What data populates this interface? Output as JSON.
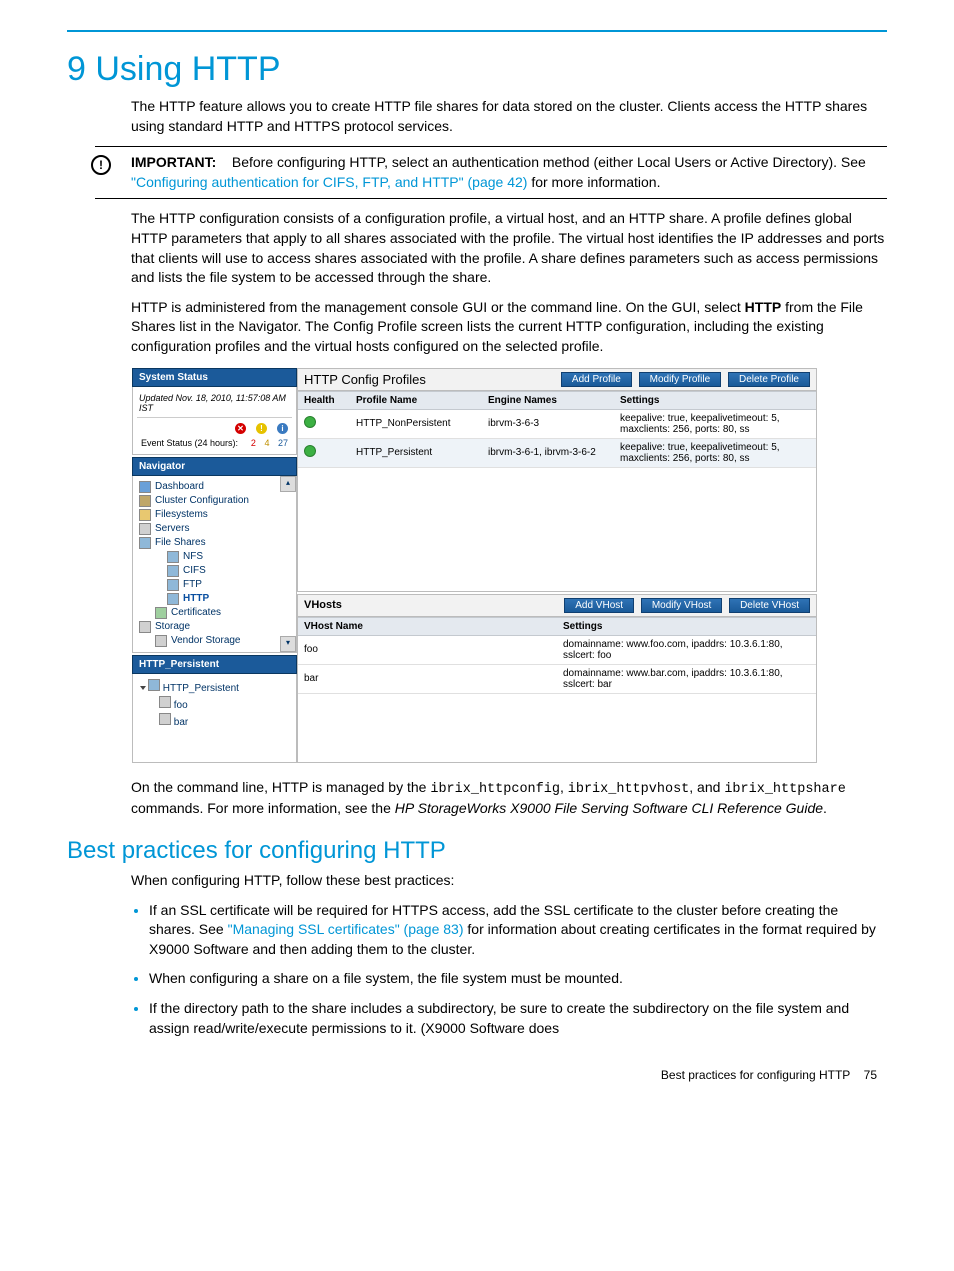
{
  "heading": "9 Using HTTP",
  "intro": "The HTTP feature allows you to create HTTP file shares for data stored on the cluster. Clients access the HTTP shares using standard HTTP and HTTPS protocol services.",
  "important": {
    "label": "IMPORTANT:",
    "text_before_link": "Before configuring HTTP, select an authentication method (either Local Users or Active Directory). See ",
    "link_text": "\"Configuring authentication for CIFS, FTP, and HTTP\" (page 42)",
    "text_after_link": " for more information."
  },
  "para2": "The HTTP configuration consists of a configuration profile, a virtual host, and an HTTP share. A profile defines global HTTP parameters that apply to all shares associated with the profile. The virtual host identifies the IP addresses and ports that clients will use to access shares associated with the profile. A share defines parameters such as access permissions and lists the file system to be accessed through the share.",
  "para3_pre": "HTTP is administered from the management console GUI or the command line. On the GUI, select ",
  "para3_bold": "HTTP",
  "para3_post": " from the File Shares list in the Navigator. The Config Profile screen lists the current HTTP configuration, including the existing configuration profiles and the virtual hosts configured on the selected profile.",
  "screenshot": {
    "system_status": {
      "title": "System Status",
      "updated": "Updated Nov. 18, 2010, 11:57:08 AM IST",
      "event_label": "Event Status (24 hours):",
      "counts": {
        "red": "2",
        "yellow": "4",
        "blue": "27"
      }
    },
    "navigator": {
      "title": "Navigator",
      "items": [
        {
          "label": "Dashboard",
          "icon": "chart"
        },
        {
          "label": "Cluster Configuration",
          "icon": "gear"
        },
        {
          "label": "Filesystems",
          "icon": "fold"
        },
        {
          "label": "Servers",
          "icon": "srv"
        },
        {
          "label": "File Shares",
          "icon": "share"
        }
      ],
      "shares": [
        {
          "label": "NFS"
        },
        {
          "label": "CIFS"
        },
        {
          "label": "FTP"
        },
        {
          "label": "HTTP",
          "selected": true
        }
      ],
      "tail": [
        {
          "label": "Certificates",
          "icon": "cert"
        },
        {
          "label": "Storage",
          "icon": "srv"
        },
        {
          "label": "Vendor Storage",
          "icon": "srv",
          "sub": true
        }
      ]
    },
    "config_profiles": {
      "title": "HTTP Config Profiles",
      "buttons": [
        "Add Profile",
        "Modify Profile",
        "Delete Profile"
      ],
      "columns": [
        "Health",
        "Profile Name",
        "Engine Names",
        "Settings"
      ],
      "rows": [
        [
          "ok",
          "HTTP_NonPersistent",
          "ibrvm-3-6-3",
          "keepalive: true, keepalivetimeout: 5, maxclients: 256, ports: 80, ss"
        ],
        [
          "ok",
          "HTTP_Persistent",
          "ibrvm-3-6-1, ibrvm-3-6-2",
          "keepalive: true, keepalivetimeout: 5, maxclients: 256, ports: 80, ss"
        ]
      ]
    },
    "hp_tree": {
      "title": "HTTP_Persistent",
      "root": "HTTP_Persistent",
      "children": [
        "foo",
        "bar"
      ]
    },
    "vhosts": {
      "title": "VHosts",
      "buttons": [
        "Add VHost",
        "Modify VHost",
        "Delete VHost"
      ],
      "columns": [
        "VHost Name",
        "Settings"
      ],
      "rows": [
        [
          "foo",
          "domainname: www.foo.com, ipaddrs: 10.3.6.1:80, sslcert: foo"
        ],
        [
          "bar",
          "domainname: www.bar.com, ipaddrs: 10.3.6.1:80, sslcert: bar"
        ]
      ]
    }
  },
  "cmdline": {
    "pre": "On the command line, HTTP is managed by the ",
    "c1": "ibrix_httpconfig",
    "sep1": ", ",
    "c2": "ibrix_httpvhost",
    "sep2": ", and ",
    "c3": "ibrix_httpshare",
    "post1": " commands. For more information, see the ",
    "emph": "HP StorageWorks X9000 File Serving Software CLI Reference Guide",
    "post2": "."
  },
  "h2": "Best practices for configuring HTTP",
  "bp_intro": "When configuring HTTP, follow these best practices:",
  "bullets": {
    "b1_pre": "If an SSL certificate will be required for HTTPS access, add the SSL certificate to the cluster before creating the shares. See ",
    "b1_link": "\"Managing SSL certificates\" (page 83)",
    "b1_post": " for information about creating certificates in the format required by X9000 Software and then adding them to the cluster.",
    "b2": "When configuring a share on a file system, the file system must be mounted.",
    "b3": "If the directory path to the share includes a subdirectory, be sure to create the subdirectory on the file system and assign read/write/execute permissions to it. (X9000 Software does"
  },
  "footer": {
    "text": "Best practices for configuring HTTP",
    "page": "75"
  }
}
